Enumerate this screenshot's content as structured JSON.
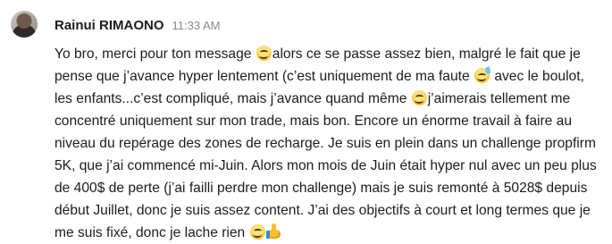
{
  "message": {
    "author": "Rainui RIMAONO",
    "time": "11:33 AM",
    "segments": [
      "Yo bro, merci pour ton message ",
      "alors ce se passe assez bien, malgré le fait que je pense que j’avance hyper lentement (c’est uniquement de ma faute ",
      " avec le boulot, les enfants...c’est compliqué, mais j’avance quand même ",
      "j’aimerais tellement me concentré uniquement sur mon trade, mais bon. Encore un énorme travail à faire au niveau du repérage des zones de recharge. Je suis en plein dans un challenge propfirm 5K, que j’ai commencé mi-Juin. Alors mon mois de Juin était hyper nul avec un peu plus de 400$ de perte (j’ai failli perdre mon challenge) mais je suis remonté à 5028$ depuis début Juillet, donc je suis assez content. J’ai des objectifs à court et long termes que je me suis fixé, donc je lache rien "
    ],
    "emojis": [
      "smiling-face-icon",
      "sweat-smile-icon",
      "smiling-face-icon",
      "smiling-face-icon",
      "thumbs-up-icon"
    ]
  }
}
